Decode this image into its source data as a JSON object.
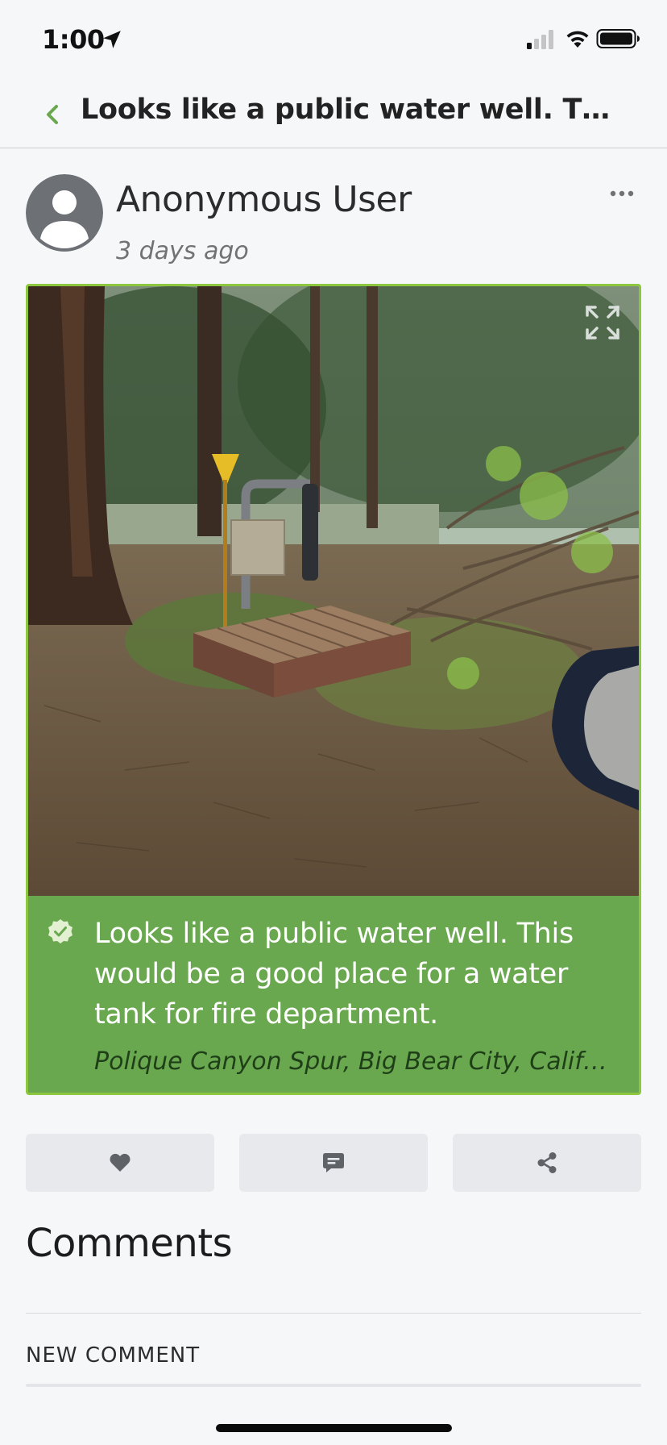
{
  "status_bar": {
    "time": "1:00",
    "location_icon": "location-arrow-icon",
    "signal_icon": "cellular-signal-icon",
    "wifi_icon": "wifi-icon",
    "battery_icon": "battery-icon"
  },
  "nav": {
    "back_icon": "chevron-left-icon",
    "title": "Looks like a public water well. This would be a good place for a water tank for fire department."
  },
  "post": {
    "author": "Anonymous User",
    "time_ago": "3 days ago",
    "avatar_icon": "user-avatar-icon",
    "more_icon": "more-dots-icon",
    "photo_description_icon": "photo",
    "expand_icon": "expand-icon",
    "check_icon": "check-circle-icon",
    "caption": "Looks like a public water well. This would be a good place for a water tank for fire department.",
    "location": "Polique Canyon Spur, Big Bear City, California"
  },
  "actions": {
    "like_icon": "heart-icon",
    "comment_icon": "comment-icon",
    "share_icon": "share-icon"
  },
  "comments": {
    "heading": "Comments",
    "new_comment_label": "NEW COMMENT"
  },
  "colors": {
    "accent": "#8dc63f",
    "caption_bg": "#6aa84f",
    "back_arrow": "#6aa84f",
    "page_bg": "#f6f7f9",
    "button_bg": "#e7e9ec"
  }
}
